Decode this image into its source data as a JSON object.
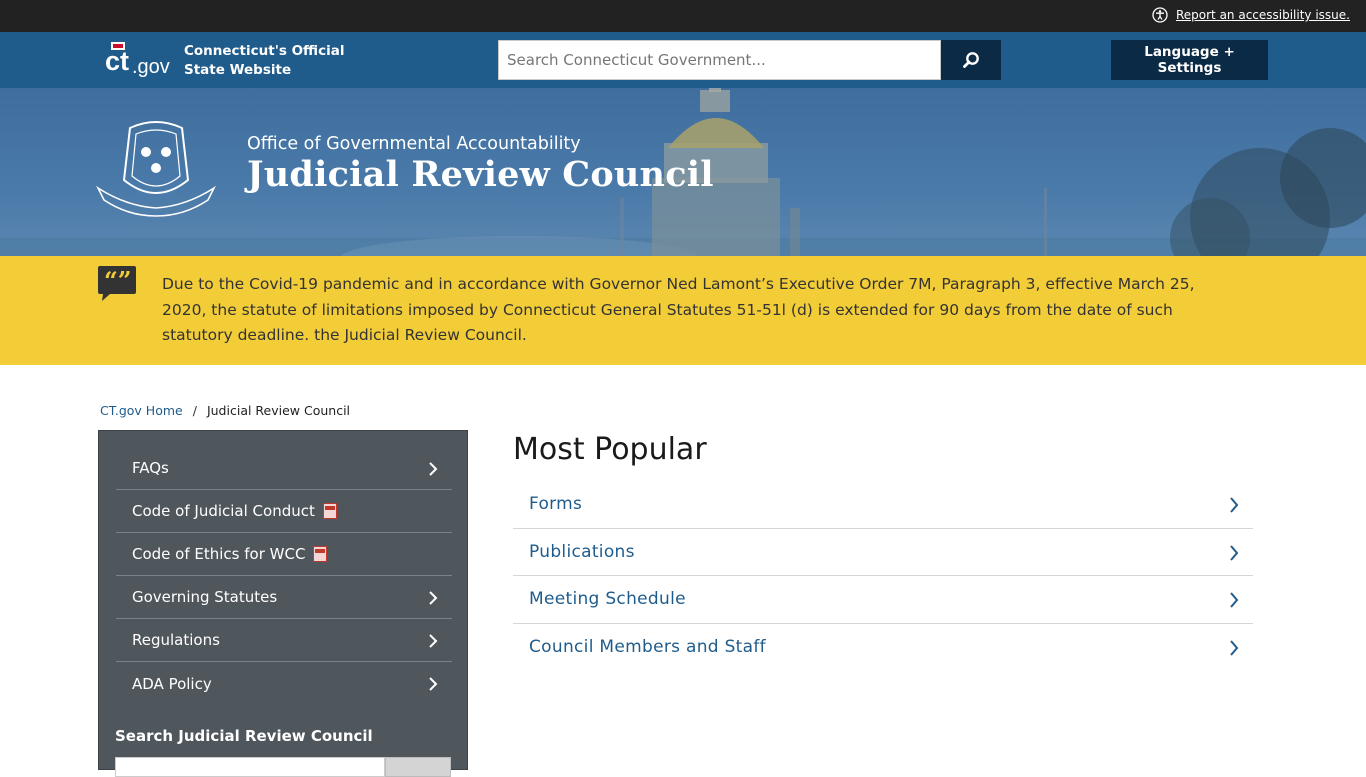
{
  "accessibility": {
    "label": "Report an accessibility issue."
  },
  "header": {
    "site_title_line1": "Connecticut's Official",
    "site_title_line2": "State Website",
    "search_placeholder": "Search Connecticut Government...",
    "language_button": "Language + Settings"
  },
  "banner": {
    "subtitle": "Office of Governmental Accountability",
    "title": "Judicial Review Council"
  },
  "alert": {
    "text": "Due to the Covid-19 pandemic and in accordance with Governor Ned Lamont’s Executive Order 7M, Paragraph 3, effective March 25, 2020, the statute of limitations imposed by Connecticut General Statutes 51-51l (d) is extended for 90 days from the date of such statutory deadline. the Judicial Review Council."
  },
  "breadcrumb": {
    "home": "CT.gov Home",
    "separator": "/",
    "current": "Judicial Review Council"
  },
  "sidenav": {
    "items": [
      {
        "label": "FAQs"
      },
      {
        "label": "Code of Judicial Conduct"
      },
      {
        "label": "Code of Ethics for WCC"
      },
      {
        "label": "Governing Statutes"
      },
      {
        "label": "Regulations"
      },
      {
        "label": "ADA Policy"
      }
    ],
    "search_label": "Search Judicial Review Council"
  },
  "main": {
    "title": "Most Popular",
    "links": [
      {
        "label": "Forms"
      },
      {
        "label": "Publications"
      },
      {
        "label": "Meeting Schedule"
      },
      {
        "label": "Council Members and Staff"
      }
    ]
  },
  "colors": {
    "header_blue": "#1f5c8c",
    "alert_yellow": "#f2cd38",
    "nav_gray": "#4f565c",
    "dark_navy": "#0b2a45"
  }
}
